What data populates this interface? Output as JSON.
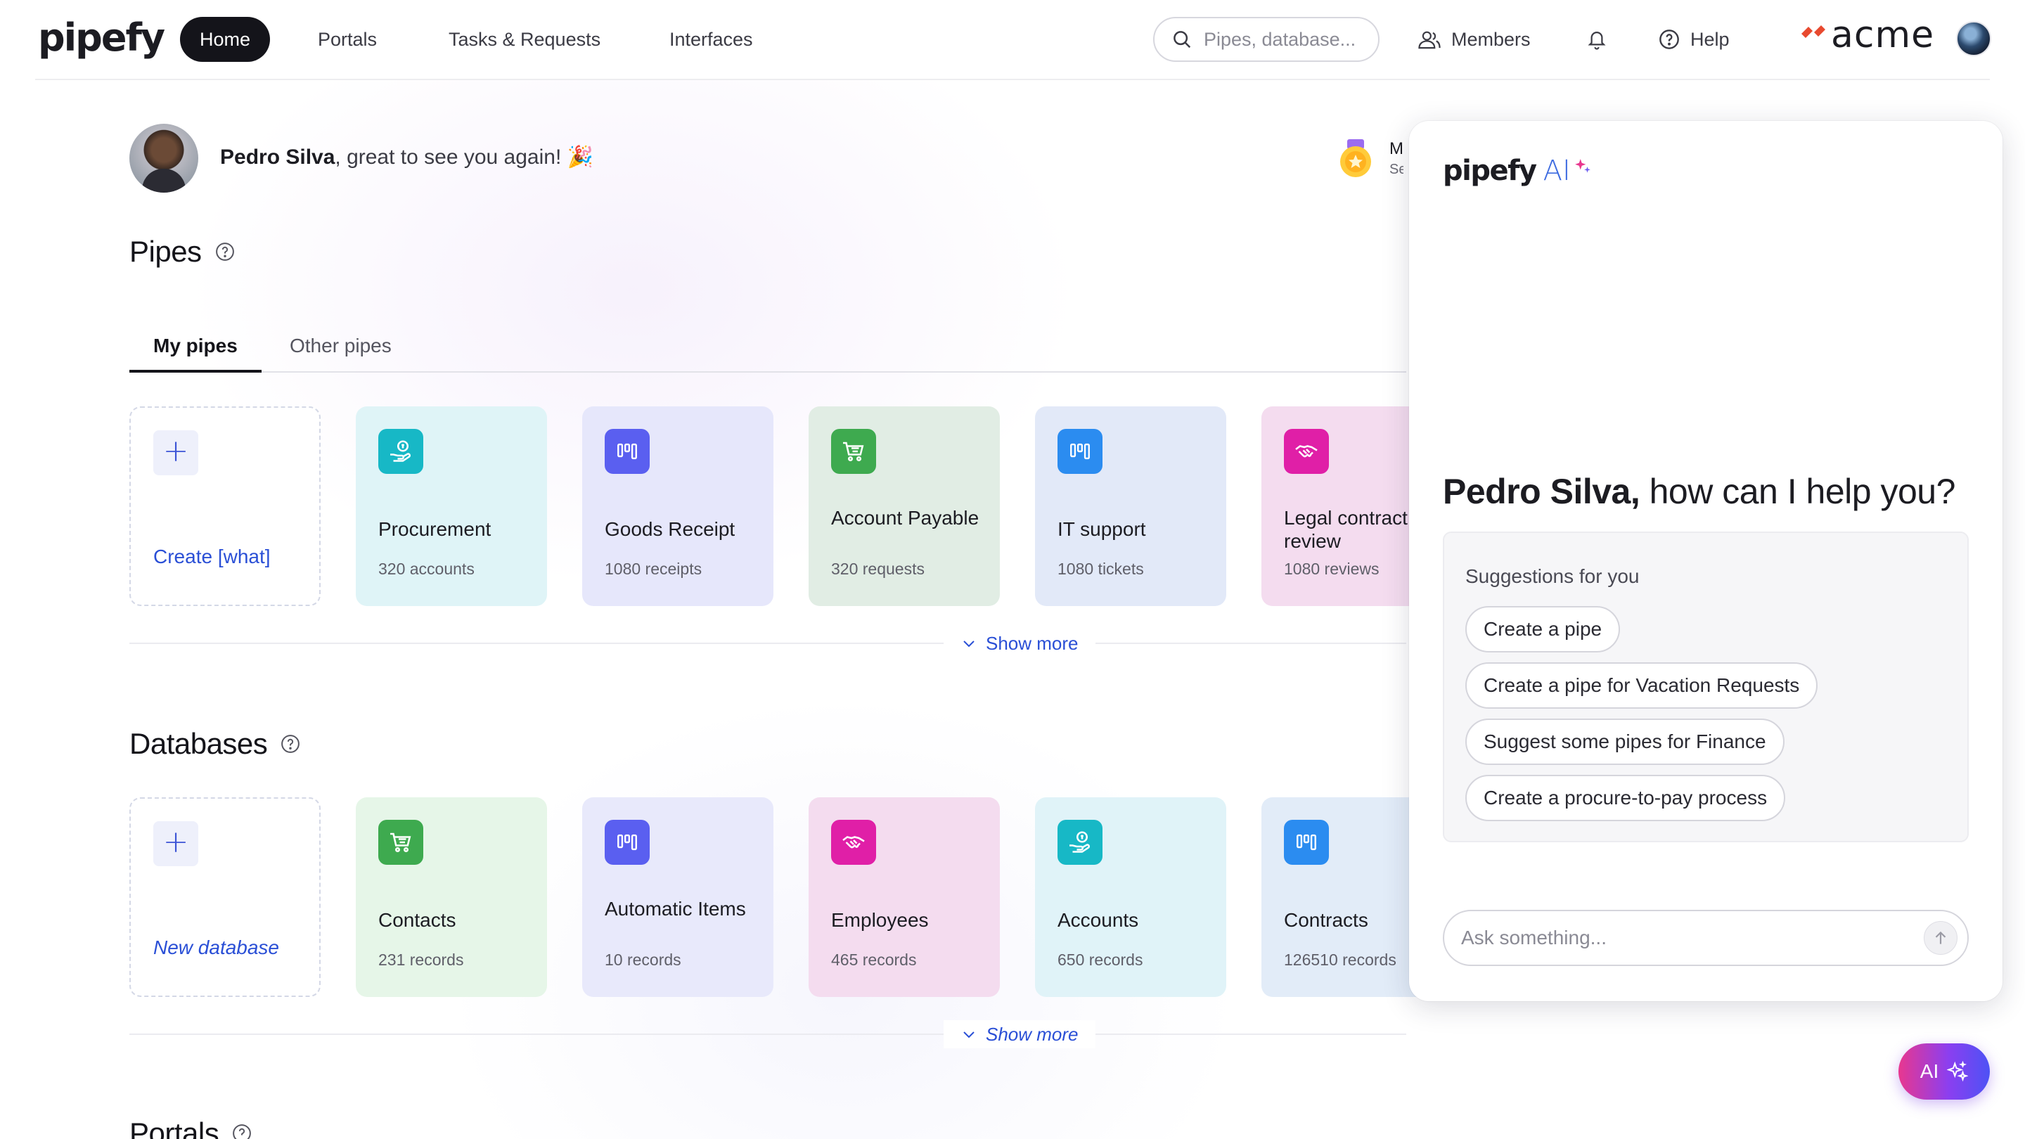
{
  "nav": {
    "logo": "pipefy",
    "items": [
      {
        "label": "Home",
        "active": true
      },
      {
        "label": "Portals"
      },
      {
        "label": "Tasks & Requests"
      },
      {
        "label": "Interfaces"
      }
    ],
    "search_placeholder": "Pipes, database...",
    "members_label": "Members",
    "help_label": "Help",
    "org_name": "acme"
  },
  "greeting": {
    "name": "Pedro Silva",
    "message": ", great to see you again! 🎉",
    "badge_title": "My",
    "badge_sub": "Se"
  },
  "pipes": {
    "title": "Pipes",
    "tabs": [
      "My pipes",
      "Other pipes"
    ],
    "create_label": "Create [what]",
    "cards": [
      {
        "name": "Procurement",
        "count": "320 accounts",
        "icon": "money-hand-icon",
        "color": "#17b8c6",
        "bg": "#dff4f7"
      },
      {
        "name": "Goods Receipt",
        "count": "1080 receipts",
        "icon": "kanban-icon",
        "color": "#5a5ff0",
        "bg": "#e6e7fb"
      },
      {
        "name": "Account Payable",
        "count": "320 requests",
        "icon": "cart-icon",
        "color": "#3eaa4f",
        "bg": "#e1ede4"
      },
      {
        "name": "IT support",
        "count": "1080 tickets",
        "icon": "kanban-icon",
        "color": "#2b8cf0",
        "bg": "#e2e9f8"
      },
      {
        "name": "Legal contract review",
        "count": "1080 reviews",
        "icon": "handshake-icon",
        "color": "#e01fa7",
        "bg": "#f4dcef"
      }
    ],
    "show_more": "Show more"
  },
  "databases": {
    "title": "Databases",
    "create_label": "New database",
    "cards": [
      {
        "name": "Contacts",
        "count": "231 records",
        "icon": "cart-icon",
        "color": "#3eaa4f",
        "bg": "#e6f6e8"
      },
      {
        "name": "Automatic Items",
        "count": "10 records",
        "icon": "kanban-icon",
        "color": "#5a5ff0",
        "bg": "#e8e9fb"
      },
      {
        "name": "Employees",
        "count": "465 records",
        "icon": "handshake-icon",
        "color": "#e01fa7",
        "bg": "#f4dcef"
      },
      {
        "name": "Accounts",
        "count": "650 records",
        "icon": "money-hand-icon",
        "color": "#17b8c6",
        "bg": "#e0f3f8"
      },
      {
        "name": "Contracts",
        "count": "126510 records",
        "icon": "kanban-icon",
        "color": "#2b8cf0",
        "bg": "#e2ecf8"
      }
    ],
    "show_more": "Show more"
  },
  "portals": {
    "title": "Portals"
  },
  "ai": {
    "logo": "pipefy",
    "logo_ai": "AI",
    "heading_name": "Pedro Silva,",
    "heading_rest": " how can I help you?",
    "suggestions_label": "Suggestions for you",
    "suggestions": [
      "Create a pipe",
      "Create a pipe for Vacation Requests",
      "Suggest some pipes for Finance",
      "Create a procure-to-pay process"
    ],
    "ask_placeholder": "Ask something...",
    "fab_label": "AI"
  },
  "colors": {
    "accent": "#2a4fd6",
    "dark": "#14141a",
    "ai_gradient": [
      "#e8378f",
      "#8b3ff0",
      "#4d52f5"
    ]
  }
}
